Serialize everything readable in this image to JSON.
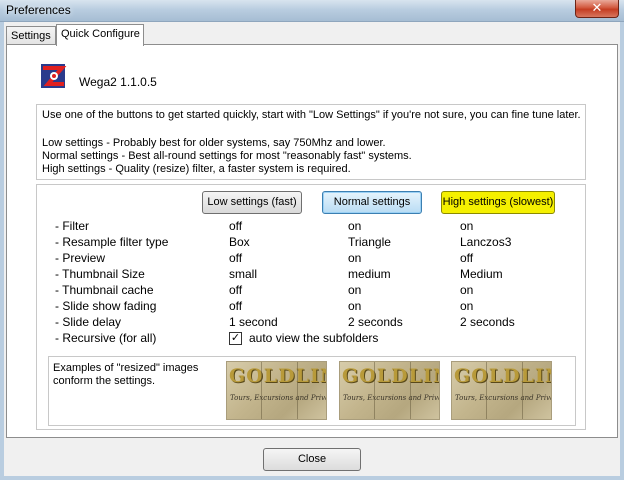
{
  "window": {
    "title": "Preferences",
    "close_glyph": "✕"
  },
  "tabs": [
    {
      "label": "Settings",
      "active": false
    },
    {
      "label": "Quick Configure",
      "active": true
    }
  ],
  "app": {
    "version": "Wega2 1.1.0.5",
    "logo_icon": "wega-logo-icon"
  },
  "intro": {
    "line1": "Use one of the buttons to get started quickly, start with \"Low Settings\" if you're not sure, you can fine tune later.",
    "low": "Low settings     - Probably best for older systems, say 750Mhz and lower.",
    "normal": "Normal settings - Best all-round settings for most \"reasonably fast\" systems.",
    "high": "High settings     - Quality (resize) filter, a faster system is required."
  },
  "presets": {
    "low": "Low settings (fast)",
    "normal": "Normal settings",
    "high": "High settings (slowest)",
    "colors": {
      "low": "#e5e5e5",
      "normal": "#c8e4f8",
      "high": "#f5f000"
    }
  },
  "options": [
    {
      "label": "- Filter",
      "low": "off",
      "normal": "on",
      "high": "on"
    },
    {
      "label": "- Resample filter type",
      "low": "Box",
      "normal": "Triangle",
      "high": "Lanczos3"
    },
    {
      "label": "- Preview",
      "low": "off",
      "normal": "on",
      "high": "off"
    },
    {
      "label": "- Thumbnail Size",
      "low": "small",
      "normal": "medium",
      "high": "Medium"
    },
    {
      "label": "- Thumbnail cache",
      "low": "off",
      "normal": "on",
      "high": "on"
    },
    {
      "label": "- Slide show fading",
      "low": "off",
      "normal": "on",
      "high": "on"
    },
    {
      "label": "- Slide delay",
      "low": "1 second",
      "normal": "2 seconds",
      "high": "2 seconds"
    },
    {
      "label": "- Recursive (for all)"
    }
  ],
  "recursive": {
    "checked": true,
    "mark": "✓",
    "label": "auto view the subfolders"
  },
  "examples": {
    "text": "Examples of \"resized\" images conform the settings.",
    "thumb_title": "GOLDLIN",
    "thumb_sub": "Tours, Excursions and Priva"
  },
  "footer": {
    "close_label": "Close"
  }
}
